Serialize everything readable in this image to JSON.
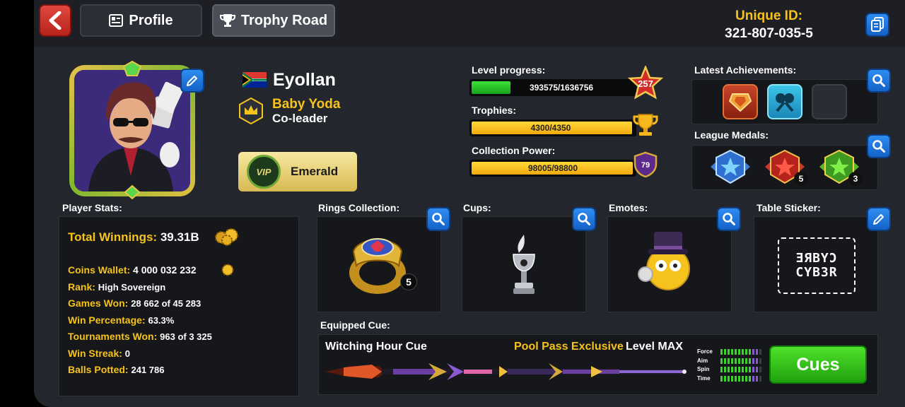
{
  "header": {
    "tab_profile": "Profile",
    "tab_trophy": "Trophy Road",
    "unique_id_label": "Unique ID:",
    "unique_id_value": "321-807-035-5"
  },
  "player": {
    "name": "Eyollan",
    "club_name": "Baby Yoda",
    "club_role": "Co-leader",
    "vip_tier": "Emerald",
    "vip_seal": "VIP"
  },
  "progress": {
    "level_label": "Level progress:",
    "level_text": "393575/1636756",
    "level_fraction": 0.24,
    "level": "257",
    "trophies_label": "Trophies:",
    "trophies_text": "4300/4350",
    "trophies_fraction": 0.985,
    "collection_label": "Collection Power:",
    "collection_text": "98005/98800",
    "collection_fraction": 0.99,
    "collection_level": "79"
  },
  "achievements": {
    "latest_label": "Latest Achievements:",
    "league_label": "League Medals:",
    "medal_red_count": "5",
    "medal_green_count": "3"
  },
  "stats": {
    "title": "Player Stats:",
    "total_winnings_key": "Total Winnings:",
    "total_winnings_val": "39.31B",
    "coins_key": "Coins Wallet:",
    "coins_val": "4 000 032 232",
    "rank_key": "Rank:",
    "rank_val": "High Sovereign",
    "games_key": "Games Won:",
    "games_val": "28 662 of 45 283",
    "winpct_key": "Win Percentage:",
    "winpct_val": "63.3%",
    "tourn_key": "Tournaments Won:",
    "tourn_val": "963 of 3 325",
    "streak_key": "Win Streak:",
    "streak_val": "0",
    "balls_key": "Balls Potted:",
    "balls_val": "241 786"
  },
  "collections": {
    "rings_label": "Rings Collection:",
    "rings_count": "5",
    "cups_label": "Cups:",
    "emotes_label": "Emotes:",
    "sticker_label": "Table Sticker:",
    "sticker_line1": "ƎЯBYƆ",
    "sticker_line2": "CYB3R"
  },
  "cue": {
    "label": "Equipped Cue:",
    "name": "Witching Hour Cue",
    "exclusive": "Pool Pass Exclusive",
    "level": "Level MAX",
    "force": "Force",
    "aim": "Aim",
    "spin": "Spin",
    "time": "Time",
    "cues_button": "Cues"
  },
  "colors": {
    "accent_gold": "#f6c21c",
    "button_blue": "#1f74dc",
    "cues_green": "#37c61c",
    "back_red": "#d23a31"
  }
}
